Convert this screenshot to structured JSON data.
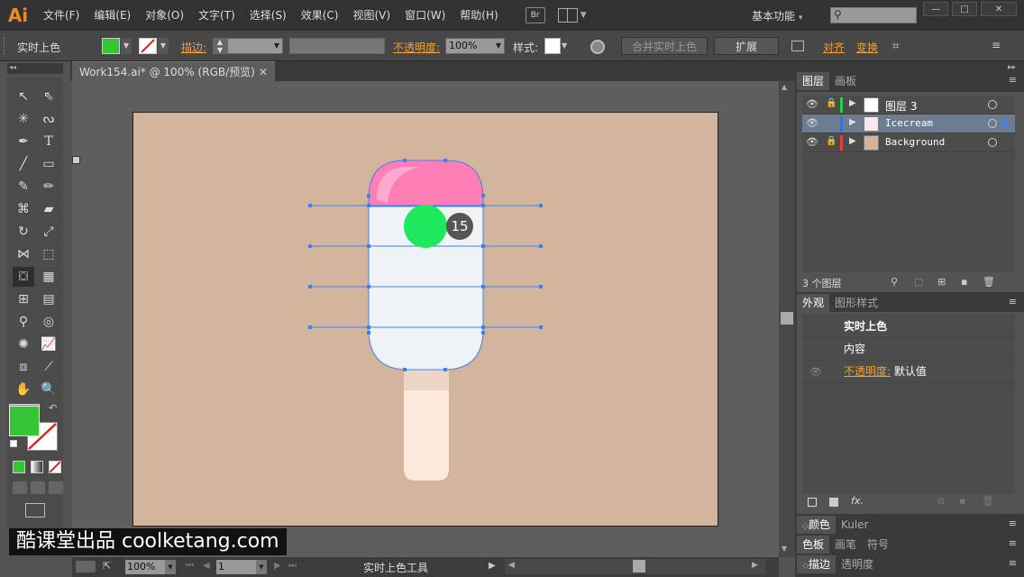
{
  "app": {
    "logo": "Ai"
  },
  "menu": [
    "文件(F)",
    "编辑(E)",
    "对象(O)",
    "文字(T)",
    "选择(S)",
    "效果(C)",
    "视图(V)",
    "窗口(W)",
    "帮助(H)"
  ],
  "menubar": {
    "bridge_label": "Br",
    "workspace": "基本功能"
  },
  "controlbar": {
    "tool_name": "实时上色",
    "stroke_label": "描边:",
    "opacity_label": "不透明度:",
    "opacity_value": "100%",
    "style_label": "样式:",
    "merge_button": "合并实时上色",
    "expand_button": "扩展",
    "align_label": "对齐",
    "transform_label": "变换"
  },
  "document": {
    "tab_title": "Work154.ai* @ 100% (RGB/预览)",
    "badge_number": "15"
  },
  "layers": {
    "tabs": [
      "图层",
      "画板"
    ],
    "items": [
      {
        "name": "图层 3",
        "color": "#2fcc48",
        "locked": true
      },
      {
        "name": "Icecream",
        "color": "#3a6fd8",
        "locked": false
      },
      {
        "name": "Background",
        "color": "#e04040",
        "locked": true
      }
    ],
    "count_label": "3 个图层"
  },
  "appearance": {
    "tabs": [
      "外观",
      "图形样式"
    ],
    "title": "实时上色",
    "content_label": "内容",
    "opacity_label": "不透明度:",
    "opacity_value": "默认值"
  },
  "bottom_panels": [
    {
      "tabs": [
        "颜色",
        "Kuler"
      ]
    },
    {
      "tabs": [
        "色板",
        "画笔",
        "符号"
      ]
    },
    {
      "tabs": [
        "描边",
        "透明度"
      ]
    }
  ],
  "statusbar": {
    "zoom": "100%",
    "page": "1",
    "status_text": "实时上色工具"
  },
  "watermark": "酷课堂出品 coolketang.com",
  "colors": {
    "fill": "#35c635",
    "artboard": "#d3b59d",
    "icecream_top": "#ff7eb5",
    "icecream_body": "#f0f3f5",
    "stick": "#fde9dc",
    "green_circle": "#1ee85e",
    "selection": "#3b82f0"
  }
}
